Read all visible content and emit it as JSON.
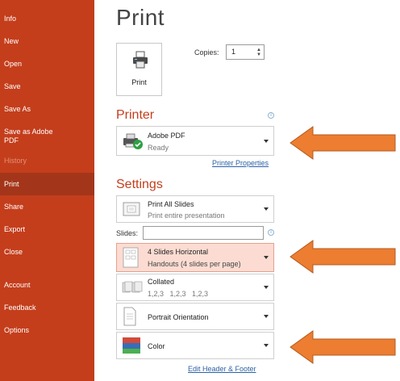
{
  "sidebar": {
    "items": [
      {
        "label": "Info"
      },
      {
        "label": "New"
      },
      {
        "label": "Open"
      },
      {
        "label": "Save"
      },
      {
        "label": "Save As"
      },
      {
        "label": "Save as Adobe PDF"
      },
      {
        "label": "History"
      },
      {
        "label": "Print"
      },
      {
        "label": "Share"
      },
      {
        "label": "Export"
      },
      {
        "label": "Close"
      },
      {
        "label": "Account"
      },
      {
        "label": "Feedback"
      },
      {
        "label": "Options"
      }
    ],
    "active": "Print",
    "disabled": "History"
  },
  "main": {
    "title": "Print",
    "print_button_label": "Print",
    "copies_label": "Copies:",
    "copies_value": "1",
    "printer": {
      "section_title": "Printer",
      "name": "Adobe PDF",
      "status": "Ready",
      "properties_link": "Printer Properties"
    },
    "settings": {
      "section_title": "Settings",
      "slides_range": {
        "title": "Print All Slides",
        "subtitle": "Print entire presentation"
      },
      "slides_label": "Slides:",
      "slides_value": "",
      "layout": {
        "title": "4 Slides Horizontal",
        "subtitle": "Handouts (4 slides per page)"
      },
      "collation": {
        "title": "Collated",
        "subtitle": "1,2,3   1,2,3   1,2,3"
      },
      "orientation": {
        "title": "Portrait Orientation"
      },
      "color": {
        "title": "Color"
      },
      "header_footer_link": "Edit Header & Footer"
    }
  },
  "colors": {
    "sidebar_bg": "#c43e1c",
    "active_item_bg": "#a3361a",
    "accent": "#c43e1c",
    "highlight_bg": "#fcdcd2",
    "arrow_fill": "#ec7d31",
    "link": "#2b62a6"
  }
}
